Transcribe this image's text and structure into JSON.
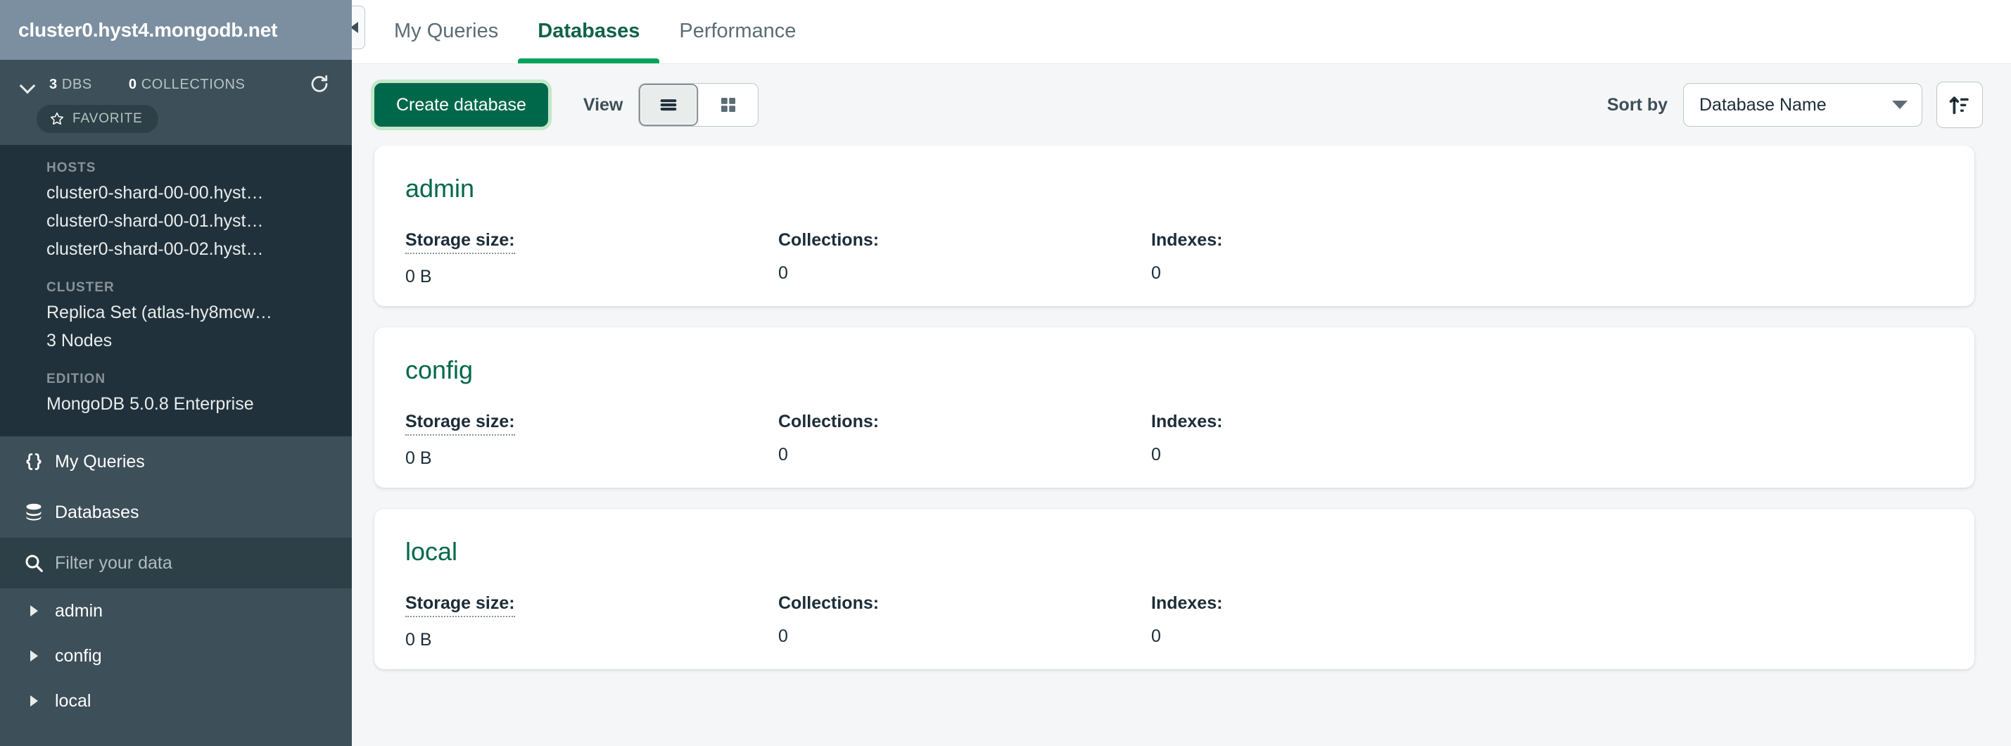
{
  "sidebar": {
    "connection_title": "cluster0.hyst4.mongodb.net",
    "stats": {
      "dbs_count": "3",
      "dbs_label": "DBS",
      "collections_count": "0",
      "collections_label": "COLLECTIONS"
    },
    "favorite_label": "FAVORITE",
    "details": [
      {
        "label": "HOSTS",
        "values": [
          "cluster0-shard-00-00.hyst…",
          "cluster0-shard-00-01.hyst…",
          "cluster0-shard-00-02.hyst…"
        ]
      },
      {
        "label": "CLUSTER",
        "values": [
          "Replica Set (atlas-hy8mcw…",
          "3 Nodes"
        ]
      },
      {
        "label": "EDITION",
        "values": [
          "MongoDB 5.0.8 Enterprise"
        ]
      }
    ],
    "nav": [
      {
        "label": "My Queries",
        "icon": "braces-icon"
      },
      {
        "label": "Databases",
        "icon": "database-icon"
      }
    ],
    "filter": {
      "placeholder": "Filter your data",
      "value": ""
    },
    "databases": [
      {
        "label": "admin"
      },
      {
        "label": "config"
      },
      {
        "label": "local"
      }
    ]
  },
  "tabs": [
    {
      "label": "My Queries",
      "active": false
    },
    {
      "label": "Databases",
      "active": true
    },
    {
      "label": "Performance",
      "active": false
    }
  ],
  "toolbar": {
    "create_label": "Create database",
    "view_label": "View",
    "view_mode": "list",
    "sort_by_label": "Sort by",
    "sort_value": "Database Name",
    "sort_direction": "ascending"
  },
  "stat_labels": {
    "storage": "Storage size:",
    "collections": "Collections:",
    "indexes": "Indexes:"
  },
  "databases": [
    {
      "name": "admin",
      "storage_size": "0 B",
      "collections": "0",
      "indexes": "0"
    },
    {
      "name": "config",
      "storage_size": "0 B",
      "collections": "0",
      "indexes": "0"
    },
    {
      "name": "local",
      "storage_size": "0 B",
      "collections": "0",
      "indexes": "0"
    }
  ],
  "colors": {
    "brand_green": "#00684A",
    "accent_green": "#00A35C",
    "sidebar_bg": "#3D4F58",
    "sidebar_header_bg": "#7C8FA0",
    "sidebar_details_bg": "#21313C",
    "canvas_bg": "#F5F6F7"
  }
}
